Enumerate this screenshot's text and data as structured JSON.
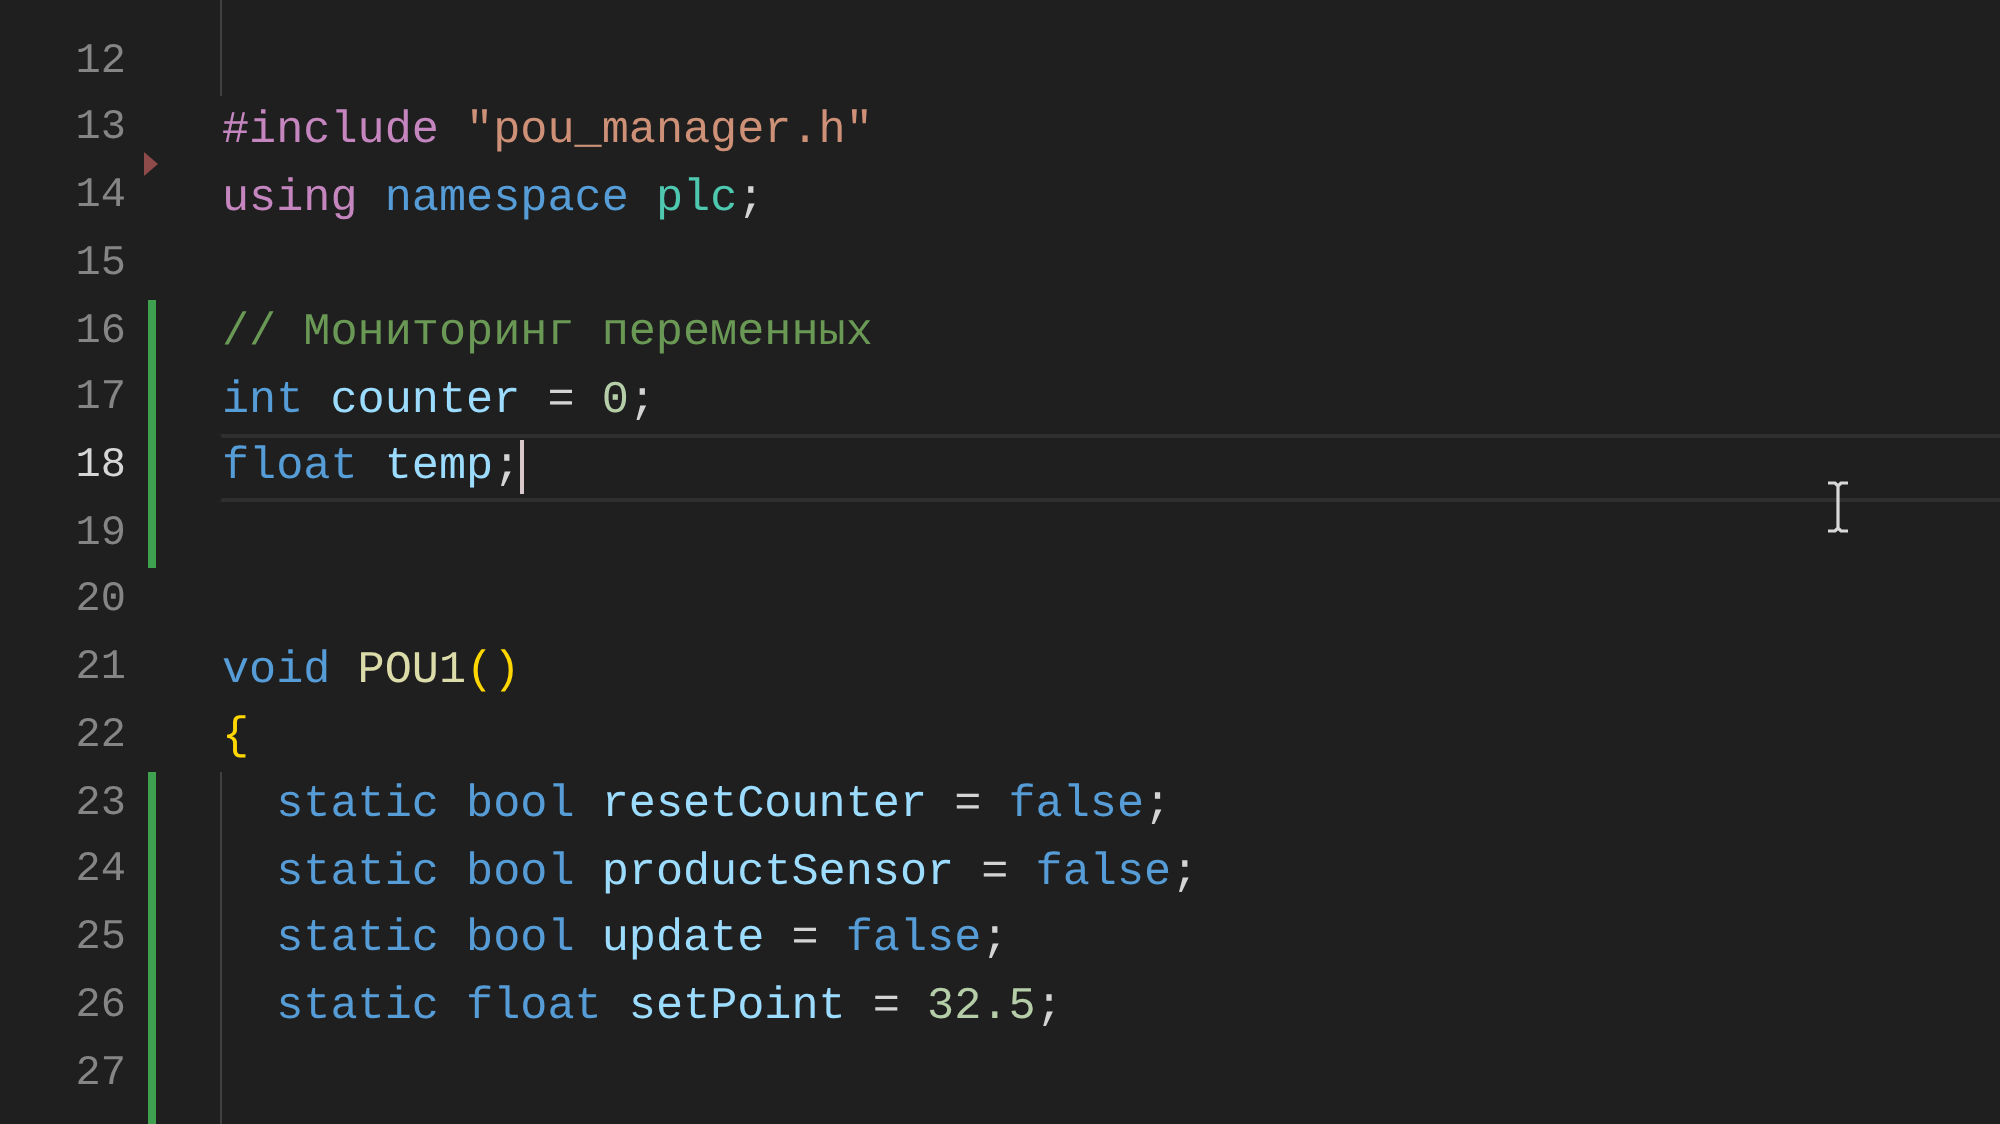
{
  "editor": {
    "lines": [
      {
        "added": false,
        "guide": true,
        "current": false,
        "caret": false,
        "deleted_after": false
      },
      {
        "number": "12",
        "added": false,
        "guide": true,
        "current": false,
        "caret": false,
        "deleted_after": false
      },
      {
        "number": "13",
        "added": false,
        "guide": false,
        "current": false,
        "caret": false,
        "deleted_after": true,
        "tokens": [
          {
            "kind": "directive",
            "text": "#include "
          },
          {
            "kind": "string",
            "text": "\"pou_manager.h\""
          }
        ]
      },
      {
        "number": "14",
        "added": false,
        "guide": false,
        "current": false,
        "caret": false,
        "deleted_after": false,
        "tokens": [
          {
            "kind": "directive",
            "text": "using "
          },
          {
            "kind": "keyword",
            "text": "namespace "
          },
          {
            "kind": "type",
            "text": "plc"
          },
          {
            "kind": "plain",
            "text": ";"
          }
        ]
      },
      {
        "number": "15",
        "added": false,
        "guide": false,
        "current": false,
        "caret": false,
        "deleted_after": false
      },
      {
        "number": "16",
        "added": true,
        "guide": false,
        "current": false,
        "caret": false,
        "deleted_after": false,
        "tokens": [
          {
            "kind": "comment",
            "text": "// Мониторинг переменных"
          }
        ]
      },
      {
        "number": "17",
        "added": true,
        "guide": false,
        "current": false,
        "caret": false,
        "deleted_after": false,
        "tokens": [
          {
            "kind": "keyword",
            "text": "int "
          },
          {
            "kind": "variable",
            "text": "counter"
          },
          {
            "kind": "plain",
            "text": " = "
          },
          {
            "kind": "number",
            "text": "0"
          },
          {
            "kind": "plain",
            "text": ";"
          }
        ]
      },
      {
        "number": "18",
        "added": true,
        "guide": false,
        "current": true,
        "caret": true,
        "deleted_after": false,
        "tokens": [
          {
            "kind": "keyword",
            "text": "float "
          },
          {
            "kind": "variable",
            "text": "temp"
          },
          {
            "kind": "plain",
            "text": ";"
          }
        ]
      },
      {
        "number": "19",
        "added": true,
        "guide": false,
        "current": false,
        "caret": false,
        "deleted_after": false
      },
      {
        "number": "20",
        "added": false,
        "guide": false,
        "current": false,
        "caret": false,
        "deleted_after": false
      },
      {
        "number": "21",
        "added": false,
        "guide": false,
        "current": false,
        "caret": false,
        "deleted_after": false,
        "tokens": [
          {
            "kind": "keyword",
            "text": "void "
          },
          {
            "kind": "function",
            "text": "POU1"
          },
          {
            "kind": "bracket",
            "text": "()"
          }
        ]
      },
      {
        "number": "22",
        "added": false,
        "guide": false,
        "current": false,
        "caret": false,
        "deleted_after": false,
        "tokens": [
          {
            "kind": "bracket",
            "text": "{"
          }
        ]
      },
      {
        "number": "23",
        "added": true,
        "guide": true,
        "current": false,
        "caret": false,
        "deleted_after": false,
        "tokens": [
          {
            "kind": "keyword",
            "text": "  static "
          },
          {
            "kind": "keyword",
            "text": "bool "
          },
          {
            "kind": "variable",
            "text": "resetCounter"
          },
          {
            "kind": "plain",
            "text": " = "
          },
          {
            "kind": "keyword",
            "text": "false"
          },
          {
            "kind": "plain",
            "text": ";"
          }
        ]
      },
      {
        "number": "24",
        "added": true,
        "guide": true,
        "current": false,
        "caret": false,
        "deleted_after": false,
        "tokens": [
          {
            "kind": "keyword",
            "text": "  static "
          },
          {
            "kind": "keyword",
            "text": "bool "
          },
          {
            "kind": "variable",
            "text": "productSensor"
          },
          {
            "kind": "plain",
            "text": " = "
          },
          {
            "kind": "keyword",
            "text": "false"
          },
          {
            "kind": "plain",
            "text": ";"
          }
        ]
      },
      {
        "number": "25",
        "added": true,
        "guide": true,
        "current": false,
        "caret": false,
        "deleted_after": false,
        "tokens": [
          {
            "kind": "keyword",
            "text": "  static "
          },
          {
            "kind": "keyword",
            "text": "bool "
          },
          {
            "kind": "variable",
            "text": "update"
          },
          {
            "kind": "plain",
            "text": " = "
          },
          {
            "kind": "keyword",
            "text": "false"
          },
          {
            "kind": "plain",
            "text": ";"
          }
        ]
      },
      {
        "number": "26",
        "added": true,
        "guide": true,
        "current": false,
        "caret": false,
        "deleted_after": false,
        "tokens": [
          {
            "kind": "keyword",
            "text": "  static "
          },
          {
            "kind": "keyword",
            "text": "float "
          },
          {
            "kind": "variable",
            "text": "setPoint"
          },
          {
            "kind": "plain",
            "text": " = "
          },
          {
            "kind": "number",
            "text": "32.5"
          },
          {
            "kind": "plain",
            "text": ";"
          }
        ]
      },
      {
        "number": "27",
        "added": true,
        "guide": true,
        "current": false,
        "caret": false,
        "deleted_after": false
      },
      {
        "added": true,
        "guide": true,
        "current": false,
        "caret": false,
        "deleted_after": false
      }
    ]
  }
}
